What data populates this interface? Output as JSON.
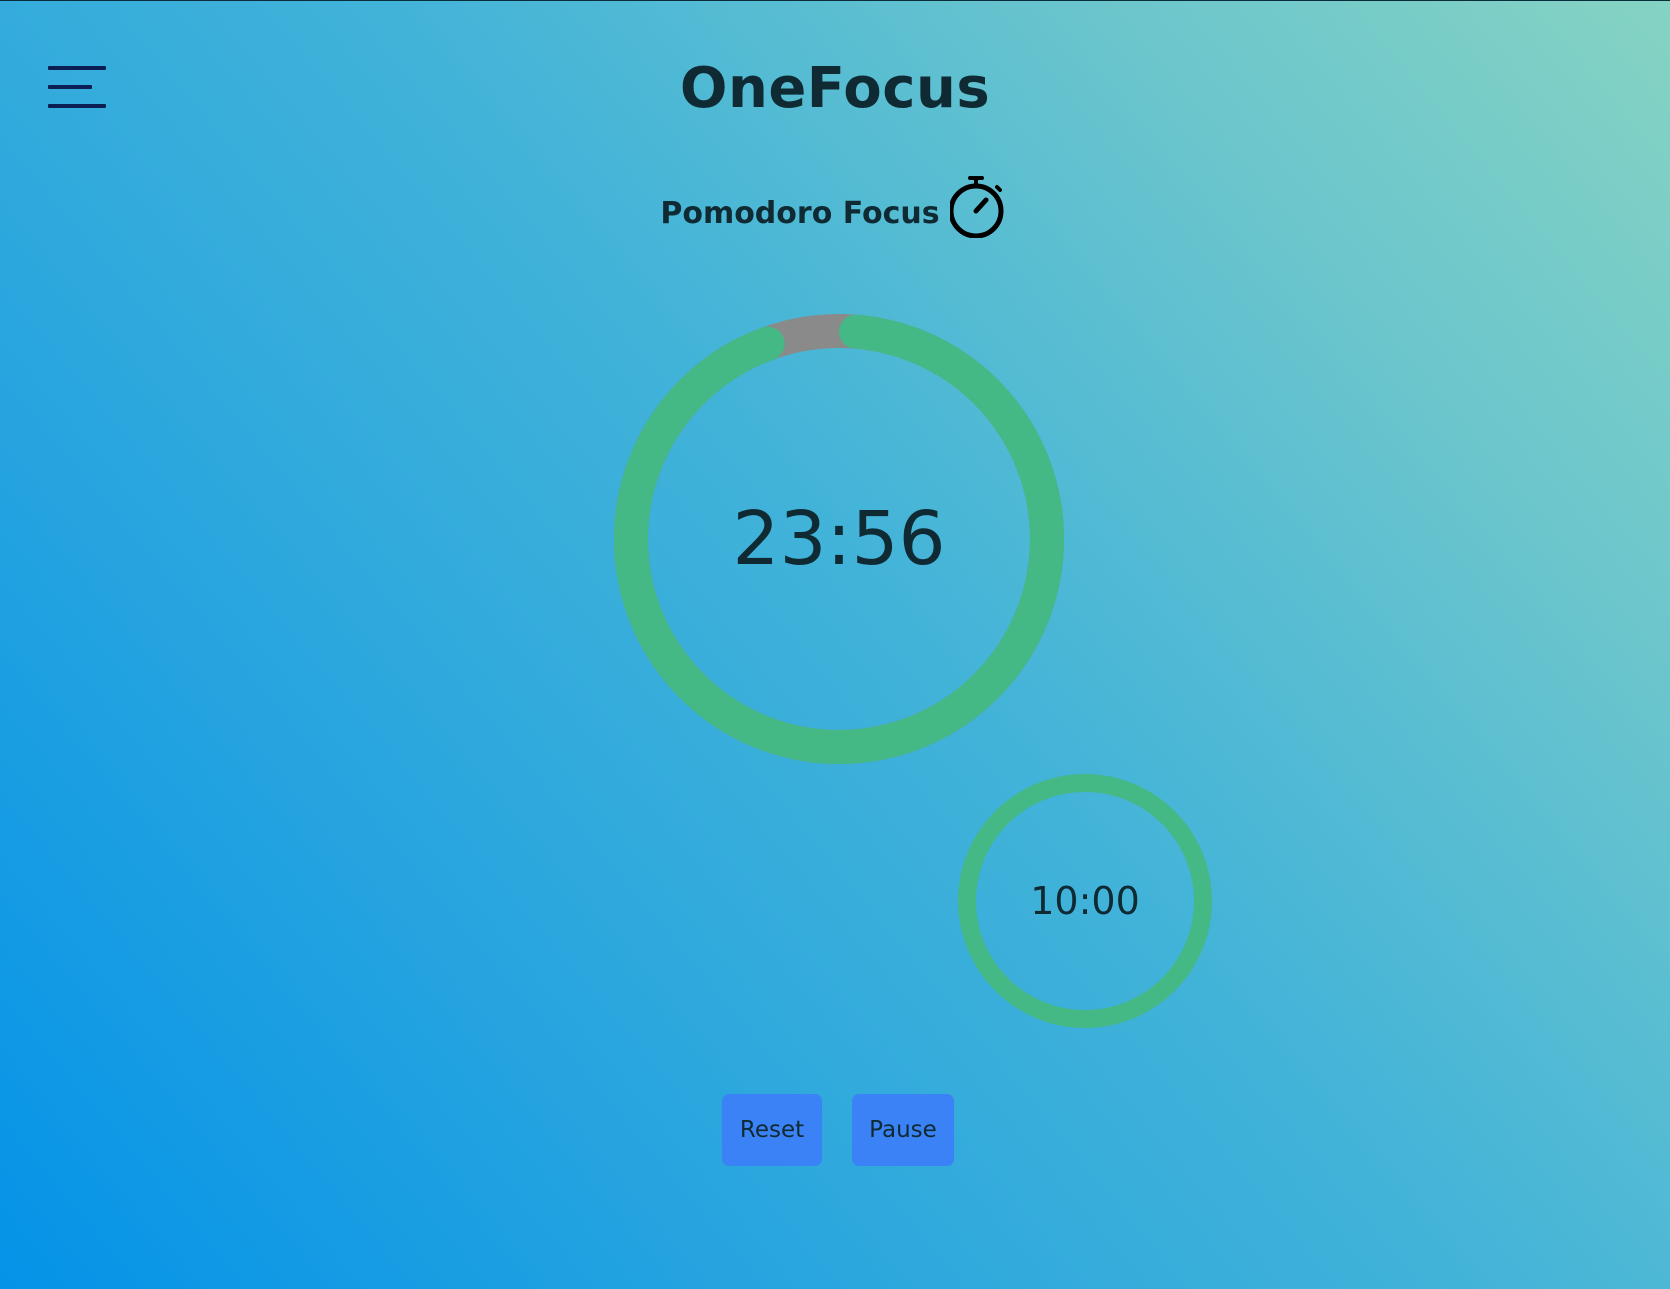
{
  "header": {
    "title": "OneFocus",
    "menu_icon": "hamburger-menu-icon"
  },
  "mode": {
    "label": "Pomodoro Focus",
    "icon": "stopwatch-icon"
  },
  "focus_timer": {
    "time": "23:56",
    "progress_remaining": 0.957,
    "ring_color": "#44b885",
    "elapsed_color": "#8a8a8a"
  },
  "break_timer": {
    "time": "10:00",
    "progress_remaining": 1.0,
    "ring_color": "#44b885"
  },
  "controls": {
    "reset_label": "Reset",
    "pause_label": "Pause",
    "button_color": "#3b82f6"
  }
}
